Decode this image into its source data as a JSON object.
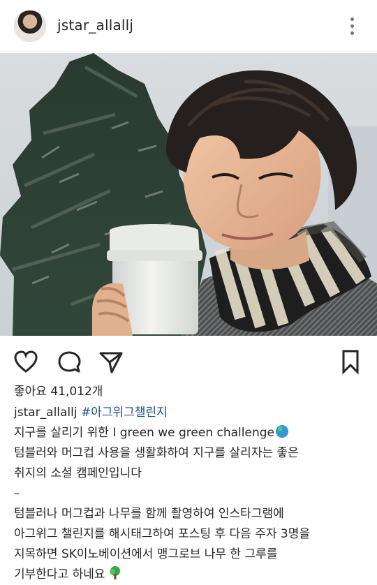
{
  "post": {
    "username": "jstar_allallj",
    "likes": "좋아요 41,012개",
    "caption": {
      "author": "jstar_allallj",
      "hashtag": "#아그위그챌린지",
      "line1": "지구를 살리기 위한 I green we green challenge",
      "line2": "텀블러와 머그컵 사용을 생활화하여 지구를 살리자는 좋은",
      "line3": "취지의 소셜 캠페인입니다",
      "separator": "–",
      "line4": "텀블러나 머그컵과 나무를 함께 촬영하여 인스타그램에",
      "line5": "아그위그 챌린지를 해시태그하여 포스팅 후 다음 주자 3명을",
      "line6": "지목하면 SK이노베이션에서 맹그로브 나무 한 그루를",
      "line7": "기부한다고 하네요"
    }
  },
  "icons": {
    "more": "more-options-icon",
    "like": "heart-icon",
    "comment": "comment-icon",
    "share": "send-icon",
    "save": "bookmark-icon"
  },
  "colors": {
    "text": "#262626",
    "hashtag": "#1f4f8c",
    "divider": "#efefef"
  }
}
